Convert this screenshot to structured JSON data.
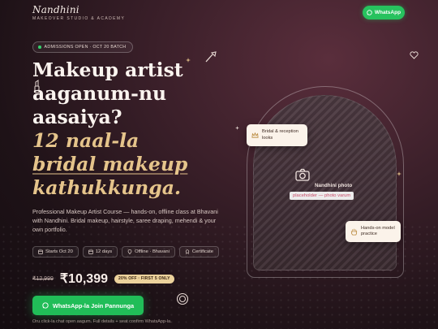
{
  "brand": {
    "name": "Nandhini",
    "tagline": "MAKEOVER STUDIO & ACADEMY"
  },
  "header": {
    "whatsapp_label": "WhatsApp"
  },
  "hero": {
    "badge": "ADMISSIONS OPEN · OCT 20 BATCH",
    "headline": {
      "line1": "Makeup artist",
      "line2": "aaganum-nu",
      "line3": "aasaiya?",
      "line4": "12 naal-la",
      "line5": "bridal makeup",
      "line6": "kathukkunga."
    },
    "description": "Professional Makeup Artist Course — hands-on, offline class at Bhavani with Nandhini. Bridal makeup, hairstyle, saree draping, mehendi & your own portfolio.",
    "chips": [
      {
        "icon": "calendar-icon",
        "label": "Starts Oct 20"
      },
      {
        "icon": "calendar-icon",
        "label": "12 days"
      },
      {
        "icon": "location-pin-icon",
        "label": "Offline · Bhavani"
      },
      {
        "icon": "certificate-icon",
        "label": "Certificate"
      }
    ],
    "old_price": "₹12,999",
    "price": "₹10,399",
    "offer": "20% OFF · FIRST 5 ONLY",
    "cta_label": "WhatsApp-la Join Pannunga",
    "footnote": "Oru click-la chat open aagum. Full details + seat confirm WhatsApp-la."
  },
  "photo": {
    "label": "Nandhini photo",
    "placeholder": "placeholder — photo varum",
    "card_top": "Bridal & reception looks",
    "card_bottom": "Hands-on model practice"
  },
  "colors": {
    "accent_gold": "#e5c48b",
    "whatsapp_green": "#21bd58",
    "background": "#1e1217"
  }
}
